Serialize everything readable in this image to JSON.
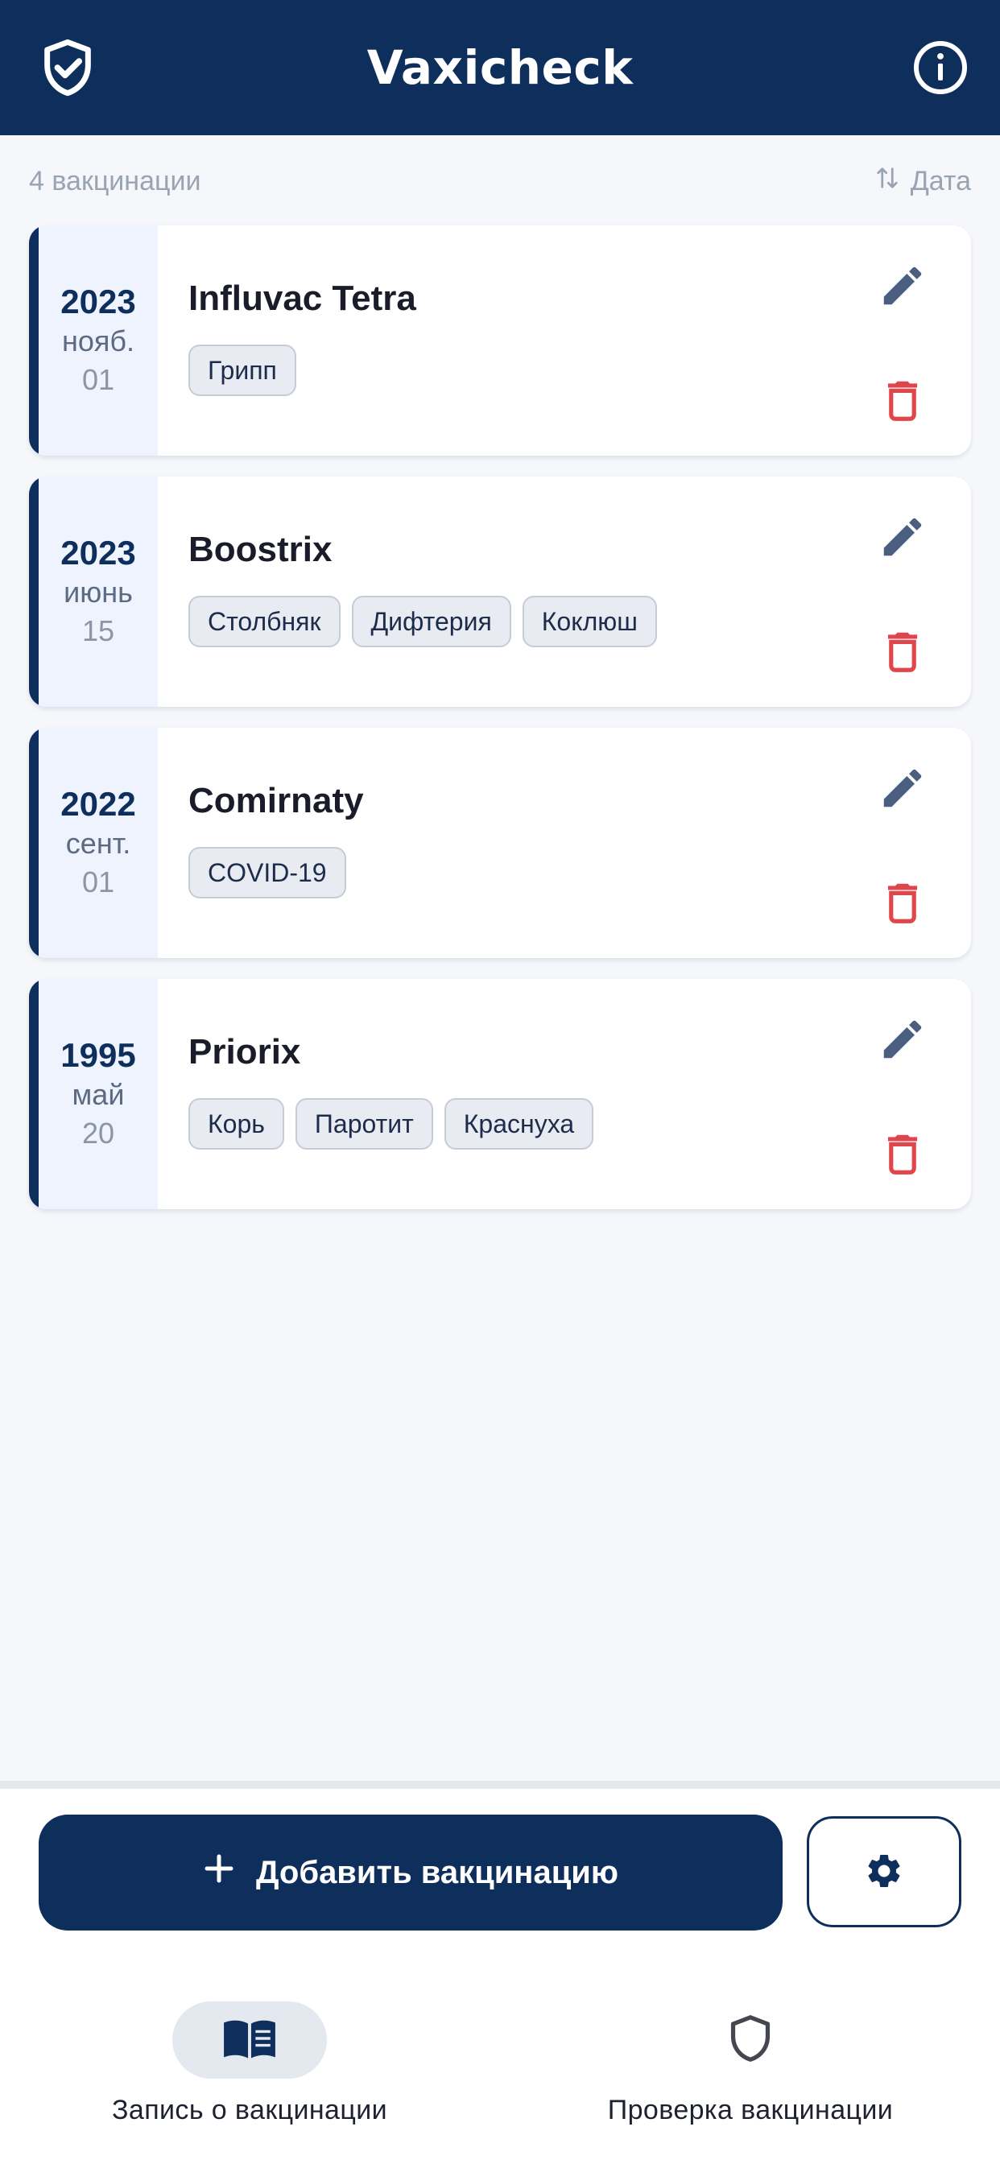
{
  "header": {
    "title": "Vaxicheck",
    "left_icon": "shield-check-icon",
    "right_icon": "info-icon"
  },
  "list": {
    "count_label": "4 вакцинации",
    "sort_label": "Дата",
    "sort_icon": "sort-arrows-icon"
  },
  "vaccinations": [
    {
      "year": "2023",
      "month": "нояб.",
      "day": "01",
      "name": "Influvac Tetra",
      "tags": [
        "Грипп"
      ]
    },
    {
      "year": "2023",
      "month": "июнь",
      "day": "15",
      "name": "Boostrix",
      "tags": [
        "Столбняк",
        "Дифтерия",
        "Коклюш"
      ]
    },
    {
      "year": "2022",
      "month": "сент.",
      "day": "01",
      "name": "Comirnaty",
      "tags": [
        "COVID-19"
      ]
    },
    {
      "year": "1995",
      "month": "май",
      "day": "20",
      "name": "Priorix",
      "tags": [
        "Корь",
        "Паротит",
        "Краснуха"
      ]
    }
  ],
  "actions": {
    "add_label": "Добавить вакцинацию",
    "add_icon": "plus-icon",
    "settings_icon": "gear-icon"
  },
  "nav": {
    "items": [
      {
        "label": "Запись о вакцинации",
        "icon": "book-icon",
        "active": true
      },
      {
        "label": "Проверка вакцинации",
        "icon": "shield-icon",
        "active": false
      }
    ]
  },
  "colors": {
    "primary": "#0e2e5c",
    "background": "#f5f7fb",
    "date_panel": "#eef3fd",
    "delete": "#e0454b",
    "edit": "#4a5f80",
    "tag_bg": "#e8ebf1"
  }
}
